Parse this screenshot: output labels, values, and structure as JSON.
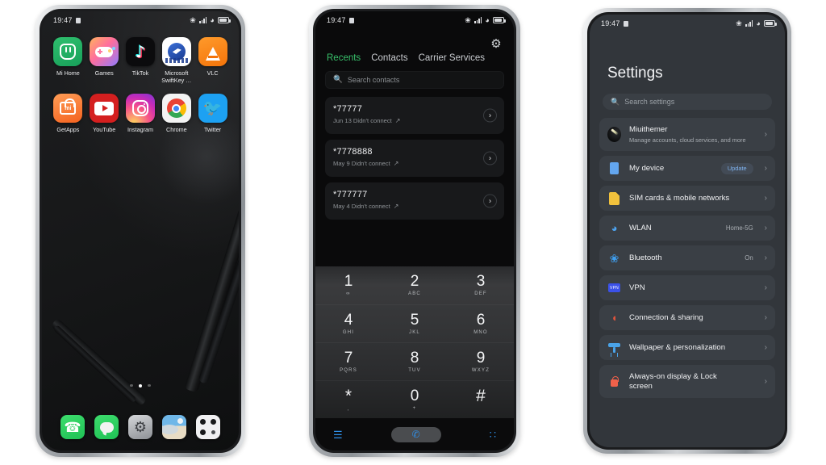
{
  "statusbar": {
    "time": "19:47",
    "icons": [
      "screen-record-icon",
      "bluetooth-icon",
      "signal-icon",
      "wifi-icon",
      "battery-icon"
    ]
  },
  "home": {
    "apps_row1": [
      {
        "label": "Mi Home",
        "icon": "mi-home-icon"
      },
      {
        "label": "Games",
        "icon": "games-icon"
      },
      {
        "label": "TikTok",
        "icon": "tiktok-icon"
      },
      {
        "label": "Microsoft SwiftKey …",
        "icon": "swiftkey-icon"
      },
      {
        "label": "VLC",
        "icon": "vlc-icon"
      }
    ],
    "apps_row2": [
      {
        "label": "GetApps",
        "icon": "getapps-icon"
      },
      {
        "label": "YouTube",
        "icon": "youtube-icon"
      },
      {
        "label": "Instagram",
        "icon": "instagram-icon"
      },
      {
        "label": "Chrome",
        "icon": "chrome-icon"
      },
      {
        "label": "Twitter",
        "icon": "twitter-icon"
      }
    ],
    "page_dots": {
      "count": 3,
      "active_index": 1
    },
    "dock": [
      {
        "name": "phone-dock-icon"
      },
      {
        "name": "messages-dock-icon"
      },
      {
        "name": "settings-dock-icon"
      },
      {
        "name": "gallery-dock-icon"
      },
      {
        "name": "camera-dock-icon"
      }
    ]
  },
  "dialer": {
    "tabs": [
      {
        "label": "Recents",
        "active": true
      },
      {
        "label": "Contacts",
        "active": false
      },
      {
        "label": "Carrier Services",
        "active": false
      }
    ],
    "settings_icon": "⚙",
    "search": {
      "placeholder": "Search contacts",
      "value": ""
    },
    "calls": [
      {
        "number": "*77777",
        "detail": "Jun 13 Didn't connect"
      },
      {
        "number": "*7778888",
        "detail": "May 9 Didn't connect"
      },
      {
        "number": "*777777",
        "detail": "May 4 Didn't connect"
      }
    ],
    "keypad": [
      [
        {
          "num": "1",
          "sub": "∞"
        },
        {
          "num": "2",
          "sub": "ABC"
        },
        {
          "num": "3",
          "sub": "DEF"
        }
      ],
      [
        {
          "num": "4",
          "sub": "GHI"
        },
        {
          "num": "5",
          "sub": "JKL"
        },
        {
          "num": "6",
          "sub": "MNO"
        }
      ],
      [
        {
          "num": "7",
          "sub": "PQRS"
        },
        {
          "num": "8",
          "sub": "TUV"
        },
        {
          "num": "9",
          "sub": "WXYZ"
        }
      ],
      [
        {
          "num": "*",
          "sub": ","
        },
        {
          "num": "0",
          "sub": "+"
        },
        {
          "num": "#",
          "sub": ""
        }
      ]
    ],
    "bottom": {
      "menu_icon": "☰",
      "call_icon": "✆",
      "keypad_icon": "∷"
    },
    "accent_color": "#38c06a",
    "action_color": "#2f8fe8"
  },
  "settings": {
    "title": "Settings",
    "search": {
      "placeholder": "Search settings",
      "value": ""
    },
    "items": [
      {
        "label": "Miuithemer",
        "sub": "Manage accounts, cloud services, and more",
        "value": "",
        "badge": "",
        "icon": "miui-account-icon"
      },
      {
        "label": "My device",
        "sub": "",
        "value": "",
        "badge": "Update",
        "icon": "device-icon"
      },
      {
        "label": "SIM cards & mobile networks",
        "sub": "",
        "value": "",
        "badge": "",
        "icon": "sim-card-icon"
      },
      {
        "label": "WLAN",
        "sub": "",
        "value": "Home-5G",
        "badge": "",
        "icon": "wifi-icon"
      },
      {
        "label": "Bluetooth",
        "sub": "",
        "value": "On",
        "badge": "",
        "icon": "bluetooth-icon"
      },
      {
        "label": "VPN",
        "sub": "",
        "value": "",
        "badge": "",
        "icon": "vpn-icon"
      },
      {
        "label": "Connection & sharing",
        "sub": "",
        "value": "",
        "badge": "",
        "icon": "connection-sharing-icon"
      },
      {
        "label": "Wallpaper & personalization",
        "sub": "",
        "value": "",
        "badge": "",
        "icon": "wallpaper-icon"
      },
      {
        "label": "Always-on display & Lock screen",
        "sub": "",
        "value": "",
        "badge": "",
        "icon": "lock-icon"
      }
    ],
    "chevron": "›",
    "bg_color": "#32363b",
    "card_color": "#3a3f45"
  }
}
